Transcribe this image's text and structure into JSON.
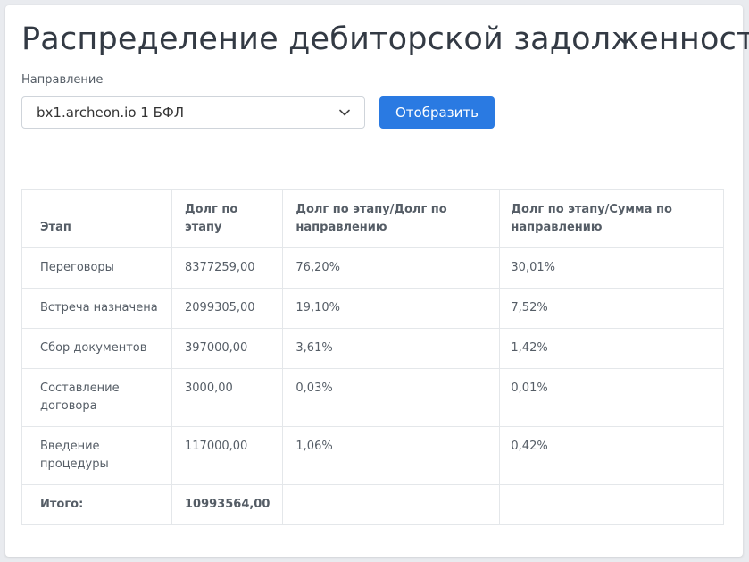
{
  "page": {
    "title": "Распределение дебиторской задолженности"
  },
  "filter": {
    "label": "Направление",
    "selected_value": "bx1.archeon.io 1 БФЛ",
    "submit_label": "Отобразить"
  },
  "table": {
    "headers": [
      "Этап",
      "Долг по этапу",
      "Долг по этапу/Долг по направлению",
      "Долг по этапу/Сумма по направлению"
    ],
    "rows": [
      [
        "Переговоры",
        "8377259,00",
        "76,20%",
        "30,01%"
      ],
      [
        "Встреча назначена",
        "2099305,00",
        "19,10%",
        "7,52%"
      ],
      [
        "Сбор документов",
        "397000,00",
        "3,61%",
        "1,42%"
      ],
      [
        "Составление договора",
        "3000,00",
        "0,03%",
        "0,01%"
      ],
      [
        "Введение процедуры",
        "117000,00",
        "1,06%",
        "0,42%"
      ]
    ],
    "total": [
      "Итого:",
      "10993564,00",
      "",
      ""
    ]
  },
  "colors": {
    "accent": "#2a7ae2",
    "border": "#e4e7ea",
    "text": "#555d66"
  }
}
